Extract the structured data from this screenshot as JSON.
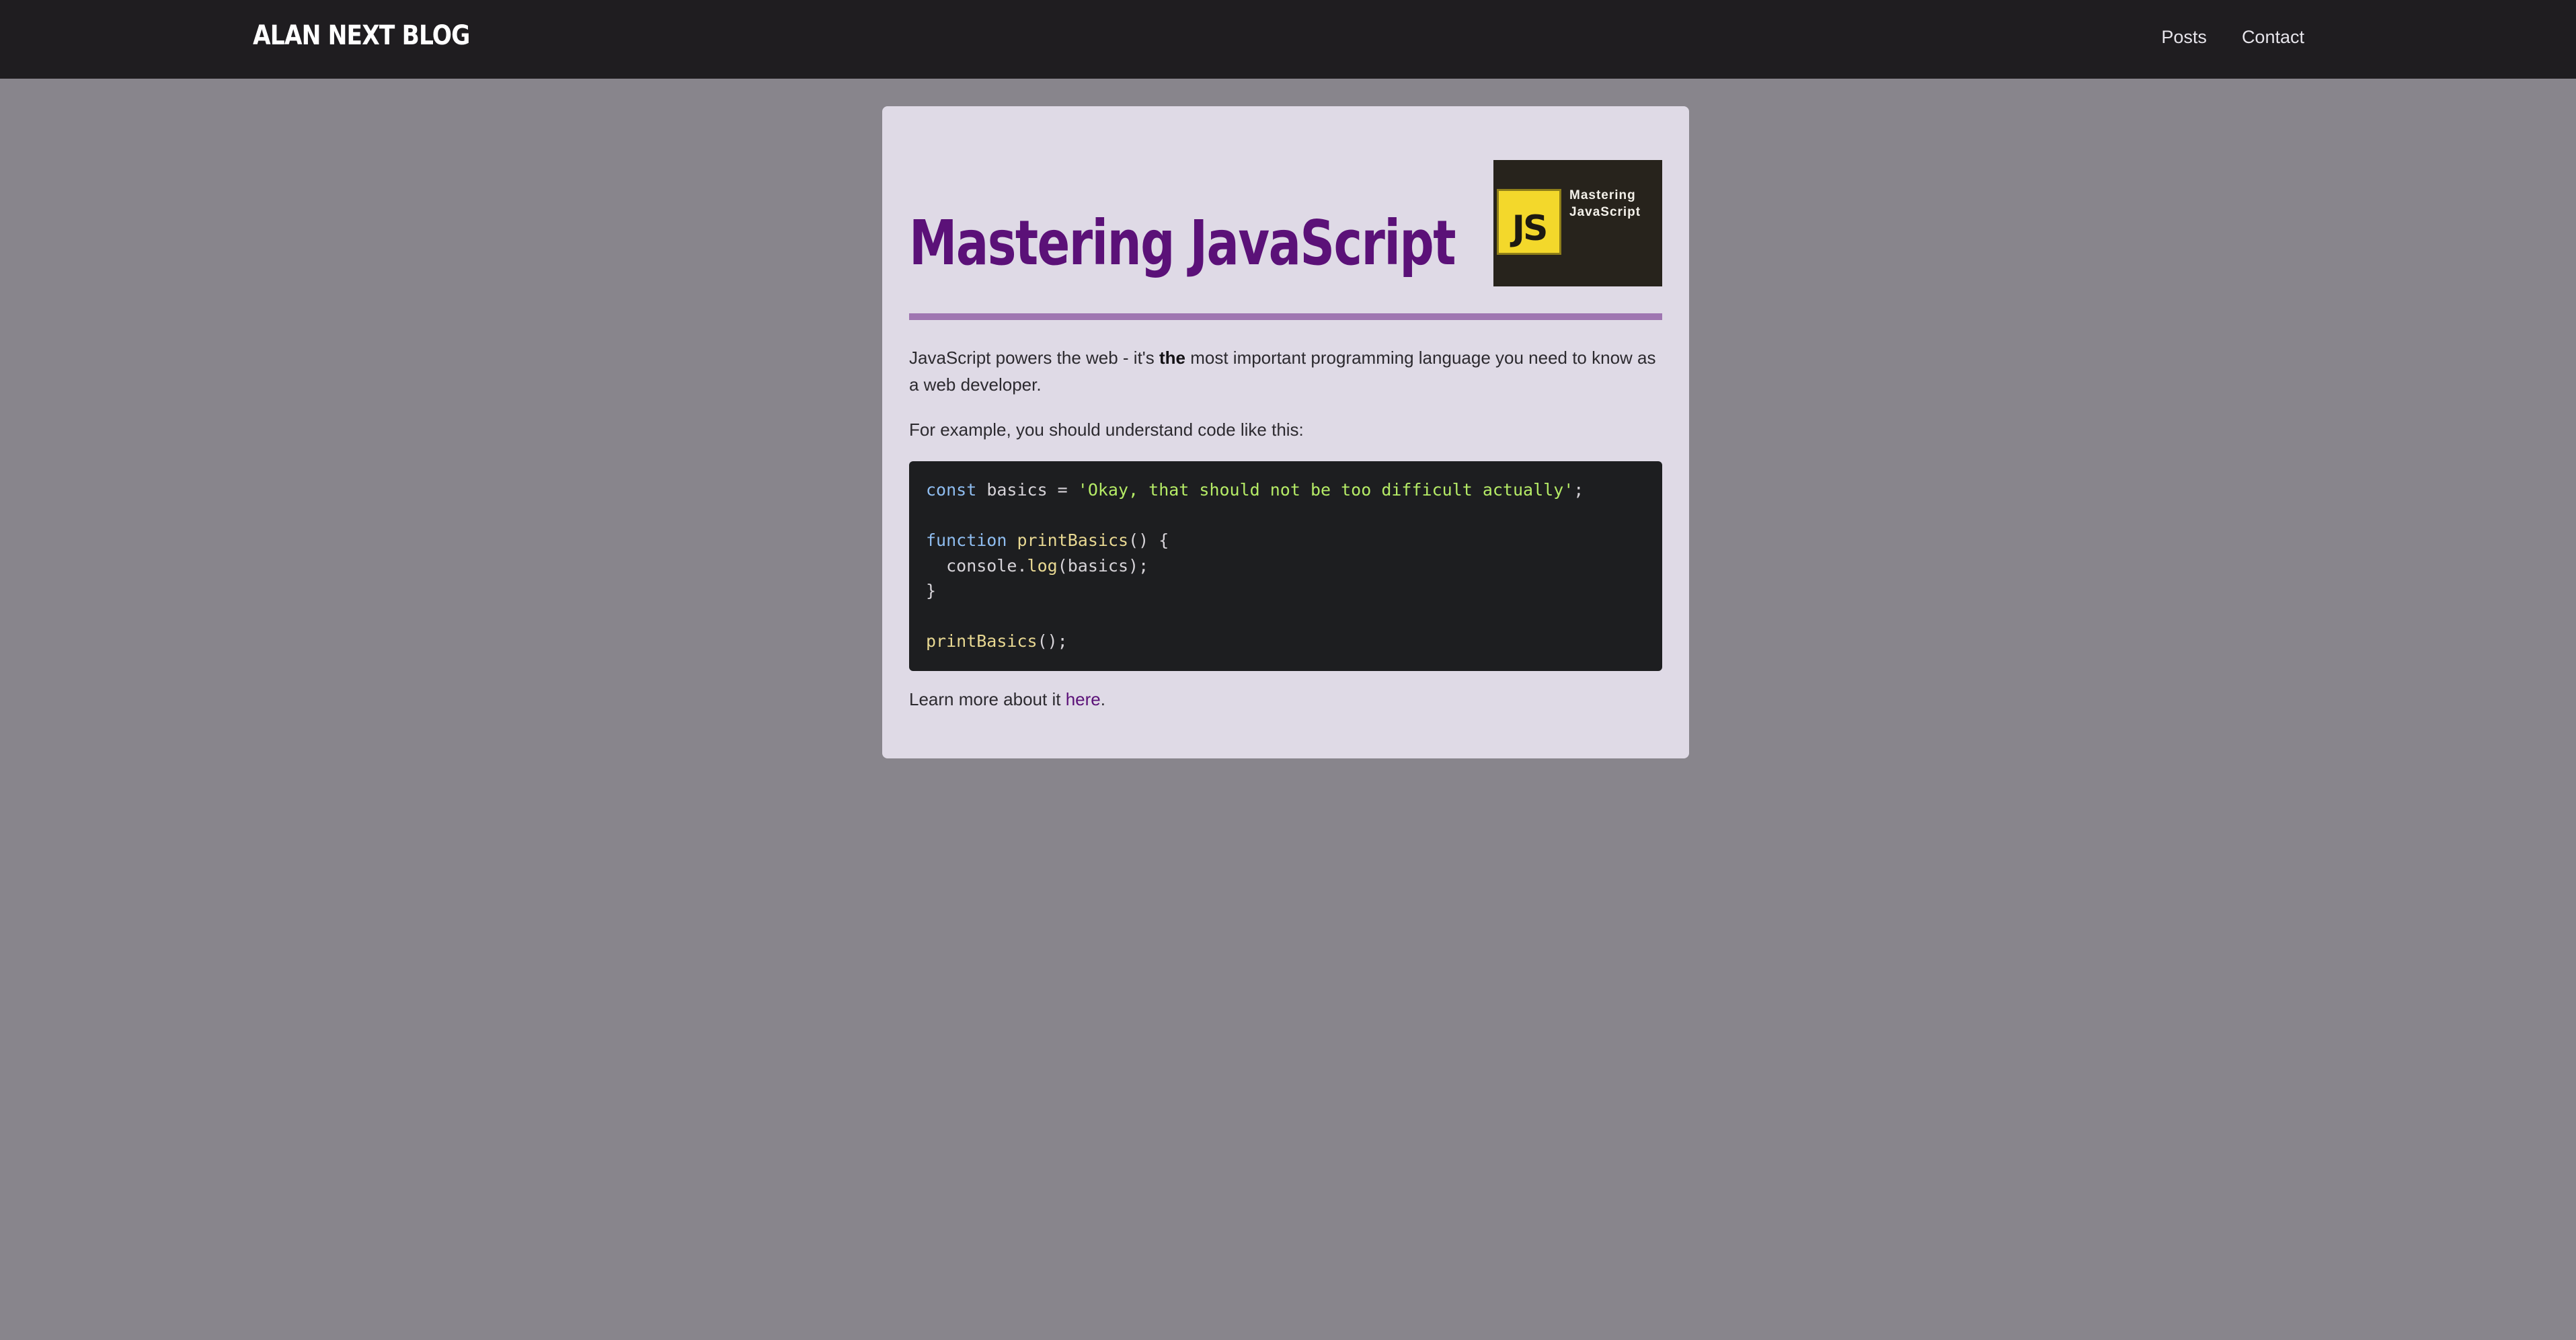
{
  "header": {
    "logo": "ALAN NEXT BLOG",
    "nav": [
      {
        "label": "Posts"
      },
      {
        "label": "Contact"
      }
    ]
  },
  "post": {
    "title": "Mastering JavaScript",
    "image": {
      "badge": "JS",
      "caption": "Mastering\nJavaScript"
    },
    "intro_before": "JavaScript powers the web - it's ",
    "intro_bold": "the",
    "intro_after": " most important programming language you need to know as a web developer.",
    "example_text": "For example, you should understand code like this:",
    "code": {
      "line1": {
        "kw": "const",
        "rest_a": " basics = ",
        "str": "'Okay, that should not be too difficult actually'",
        "rest_b": ";"
      },
      "line3": {
        "kw": "function",
        "sp": " ",
        "fn": "printBasics",
        "rest": "() {"
      },
      "line4": {
        "pre": "  console.",
        "fn": "log",
        "rest": "(basics);"
      },
      "line5": "}",
      "line7": {
        "fn": "printBasics",
        "rest": "();"
      }
    },
    "learn_more_before": "Learn more about it ",
    "learn_more_link": "here",
    "learn_more_after": "."
  },
  "colors": {
    "header_bg": "#1f1d20",
    "page_bg": "#88858c",
    "card_bg": "#dfdae6",
    "title": "#5b1178",
    "divider": "#9f76b1",
    "code_bg": "#1d1e20",
    "js_yellow": "#f3d82b"
  },
  "icons": {
    "post_image": "javascript-logo"
  }
}
